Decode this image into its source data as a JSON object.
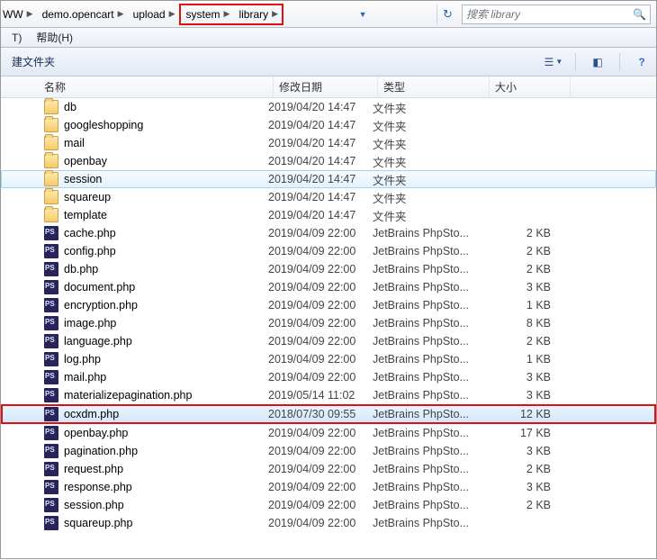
{
  "breadcrumb": {
    "items": [
      {
        "label": "WW"
      },
      {
        "label": "demo.opencart"
      },
      {
        "label": "upload"
      },
      {
        "label": "system"
      },
      {
        "label": "library"
      }
    ]
  },
  "search": {
    "placeholder": "搜索 library"
  },
  "menu": {
    "item1": "T)",
    "item2": "帮助(H)"
  },
  "toolbar": {
    "newFolder": "建文件夹"
  },
  "columns": {
    "name": "名称",
    "date": "修改日期",
    "type": "类型",
    "size": "大小"
  },
  "typeFolder": "文件夹",
  "typeFile": "JetBrains PhpSto...",
  "rows": [
    {
      "kind": "folder",
      "name": "db",
      "date": "2019/04/20 14:47",
      "type": "文件夹",
      "size": ""
    },
    {
      "kind": "folder",
      "name": "googleshopping",
      "date": "2019/04/20 14:47",
      "type": "文件夹",
      "size": ""
    },
    {
      "kind": "folder",
      "name": "mail",
      "date": "2019/04/20 14:47",
      "type": "文件夹",
      "size": ""
    },
    {
      "kind": "folder",
      "name": "openbay",
      "date": "2019/04/20 14:47",
      "type": "文件夹",
      "size": ""
    },
    {
      "kind": "folder",
      "name": "session",
      "date": "2019/04/20 14:47",
      "type": "文件夹",
      "size": "",
      "sel": "light"
    },
    {
      "kind": "folder",
      "name": "squareup",
      "date": "2019/04/20 14:47",
      "type": "文件夹",
      "size": ""
    },
    {
      "kind": "folder",
      "name": "template",
      "date": "2019/04/20 14:47",
      "type": "文件夹",
      "size": ""
    },
    {
      "kind": "file",
      "name": "cache.php",
      "date": "2019/04/09 22:00",
      "type": "JetBrains PhpSto...",
      "size": "2 KB"
    },
    {
      "kind": "file",
      "name": "config.php",
      "date": "2019/04/09 22:00",
      "type": "JetBrains PhpSto...",
      "size": "2 KB"
    },
    {
      "kind": "file",
      "name": "db.php",
      "date": "2019/04/09 22:00",
      "type": "JetBrains PhpSto...",
      "size": "2 KB"
    },
    {
      "kind": "file",
      "name": "document.php",
      "date": "2019/04/09 22:00",
      "type": "JetBrains PhpSto...",
      "size": "3 KB"
    },
    {
      "kind": "file",
      "name": "encryption.php",
      "date": "2019/04/09 22:00",
      "type": "JetBrains PhpSto...",
      "size": "1 KB"
    },
    {
      "kind": "file",
      "name": "image.php",
      "date": "2019/04/09 22:00",
      "type": "JetBrains PhpSto...",
      "size": "8 KB"
    },
    {
      "kind": "file",
      "name": "language.php",
      "date": "2019/04/09 22:00",
      "type": "JetBrains PhpSto...",
      "size": "2 KB"
    },
    {
      "kind": "file",
      "name": "log.php",
      "date": "2019/04/09 22:00",
      "type": "JetBrains PhpSto...",
      "size": "1 KB"
    },
    {
      "kind": "file",
      "name": "mail.php",
      "date": "2019/04/09 22:00",
      "type": "JetBrains PhpSto...",
      "size": "3 KB"
    },
    {
      "kind": "file",
      "name": "materializepagination.php",
      "date": "2019/05/14 11:02",
      "type": "JetBrains PhpSto...",
      "size": "3 KB"
    },
    {
      "kind": "file",
      "name": "ocxdm.php",
      "date": "2018/07/30 09:55",
      "type": "JetBrains PhpSto...",
      "size": "12 KB",
      "sel": "red"
    },
    {
      "kind": "file",
      "name": "openbay.php",
      "date": "2019/04/09 22:00",
      "type": "JetBrains PhpSto...",
      "size": "17 KB"
    },
    {
      "kind": "file",
      "name": "pagination.php",
      "date": "2019/04/09 22:00",
      "type": "JetBrains PhpSto...",
      "size": "3 KB"
    },
    {
      "kind": "file",
      "name": "request.php",
      "date": "2019/04/09 22:00",
      "type": "JetBrains PhpSto...",
      "size": "2 KB"
    },
    {
      "kind": "file",
      "name": "response.php",
      "date": "2019/04/09 22:00",
      "type": "JetBrains PhpSto...",
      "size": "3 KB"
    },
    {
      "kind": "file",
      "name": "session.php",
      "date": "2019/04/09 22:00",
      "type": "JetBrains PhpSto...",
      "size": "2 KB"
    },
    {
      "kind": "file",
      "name": "squareup.php",
      "date": "2019/04/09 22:00",
      "type": "JetBrains PhpSto...",
      "size": ""
    }
  ]
}
